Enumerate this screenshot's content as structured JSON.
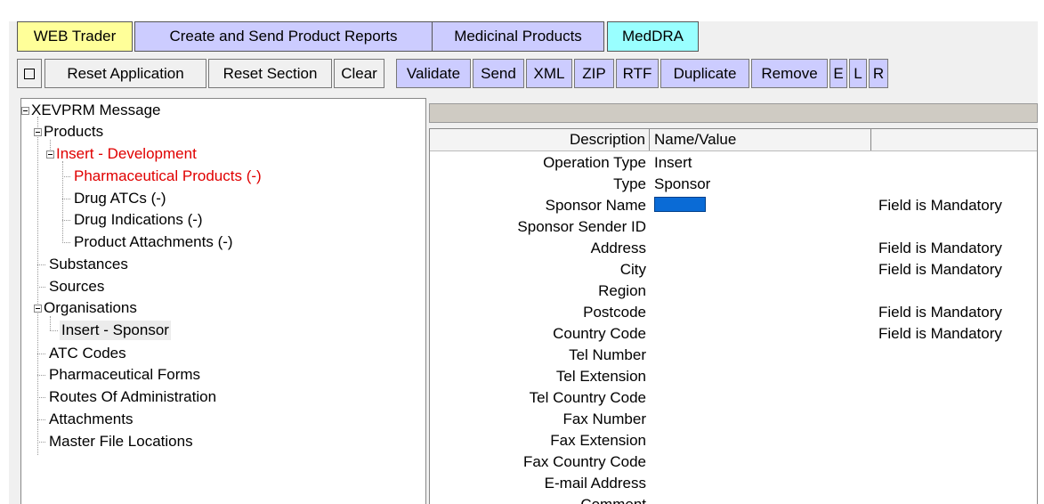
{
  "window": {
    "top_partial_text": ", …, …"
  },
  "tabs": [
    {
      "label": "WEB Trader"
    },
    {
      "label": "Create and Send Product Reports"
    },
    {
      "label": "Medicinal Products"
    },
    {
      "label": "MedDRA"
    }
  ],
  "toolbar": {
    "toggle_icon": "square-icon",
    "reset_application": "Reset Application",
    "reset_section": "Reset Section",
    "clear": "Clear",
    "validate": "Validate",
    "send": "Send",
    "xml": "XML",
    "zip": "ZIP",
    "rtf": "RTF",
    "duplicate": "Duplicate",
    "remove": "Remove",
    "e": "E",
    "l": "L",
    "r": "R"
  },
  "tree": {
    "root": "XEVPRM Message",
    "products": "Products",
    "insert_development": "Insert - Development",
    "pharmaceutical_products": "Pharmaceutical Products (-)",
    "drug_atcs": "Drug ATCs (-)",
    "drug_indications": "Drug Indications (-)",
    "product_attachments": "Product Attachments (-)",
    "substances": "Substances",
    "sources": "Sources",
    "organisations": "Organisations",
    "insert_sponsor": "Insert - Sponsor",
    "atc_codes": "ATC Codes",
    "pharmaceutical_forms": "Pharmaceutical Forms",
    "routes_of_administration": "Routes Of Administration",
    "attachments": "Attachments",
    "master_file_locations": "Master File Locations"
  },
  "grid": {
    "headers": {
      "description": "Description",
      "name_value": "Name/Value",
      "message": ""
    },
    "rows": [
      {
        "description": "Operation Type",
        "value": "Insert",
        "message": ""
      },
      {
        "description": "Type",
        "value": "Sponsor",
        "message": ""
      },
      {
        "description": "Sponsor Name",
        "value": "",
        "message": "Field is Mandatory"
      },
      {
        "description": "Sponsor Sender ID",
        "value": "",
        "message": ""
      },
      {
        "description": "Address",
        "value": "",
        "message": "Field is Mandatory"
      },
      {
        "description": "City",
        "value": "",
        "message": "Field is Mandatory"
      },
      {
        "description": "Region",
        "value": "",
        "message": ""
      },
      {
        "description": "Postcode",
        "value": "",
        "message": "Field is Mandatory"
      },
      {
        "description": "Country Code",
        "value": "",
        "message": "Field is Mandatory"
      },
      {
        "description": "Tel Number",
        "value": "",
        "message": ""
      },
      {
        "description": "Tel Extension",
        "value": "",
        "message": ""
      },
      {
        "description": "Tel Country Code",
        "value": "",
        "message": ""
      },
      {
        "description": "Fax Number",
        "value": "",
        "message": ""
      },
      {
        "description": "Fax Extension",
        "value": "",
        "message": ""
      },
      {
        "description": "Fax Country Code",
        "value": "",
        "message": ""
      },
      {
        "description": "E-mail Address",
        "value": "",
        "message": ""
      },
      {
        "description": "Comment",
        "value": "",
        "message": ""
      }
    ]
  },
  "colors": {
    "tab_web": "#ffff99",
    "tab_blue": "#ccccff",
    "tab_meddra": "#99ffff",
    "tree_red": "#e00000",
    "input_selected": "#0a6bd6"
  }
}
